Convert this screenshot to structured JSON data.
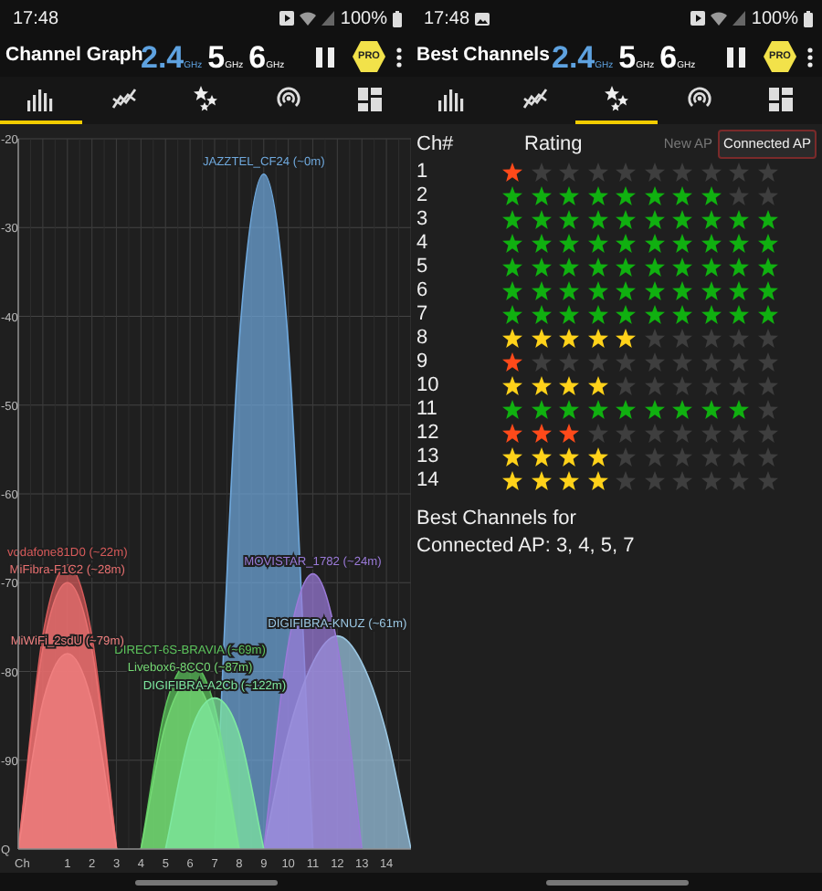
{
  "screens": [
    {
      "status_bar": {
        "time": "17:48",
        "notification": false,
        "battery": "100%"
      },
      "title": "Channel Graph",
      "bands": [
        {
          "value": "2.4",
          "unit": "GHz",
          "selected": true
        },
        {
          "value": "5",
          "unit": "GHz",
          "selected": false
        },
        {
          "value": "6",
          "unit": "GHz",
          "selected": false
        }
      ],
      "pro_badge": "PRO",
      "tabs": [
        {
          "selected": true
        },
        {
          "selected": false
        },
        {
          "selected": false
        },
        {
          "selected": false
        },
        {
          "selected": false
        }
      ],
      "chart_data": {
        "type": "area",
        "grid": true,
        "xlabel": "Ch",
        "x": [
          -1,
          0,
          1,
          2,
          3,
          4,
          5,
          6,
          7,
          8,
          9,
          10,
          11,
          12,
          13,
          14,
          15
        ],
        "xlim": [
          -1,
          15
        ],
        "ylim": [
          -100,
          -20
        ],
        "xticks": [
          1,
          2,
          3,
          4,
          5,
          6,
          7,
          8,
          9,
          10,
          11,
          12,
          13,
          14
        ],
        "yticks": [
          -20,
          -30,
          -40,
          -50,
          -60,
          -70,
          -80,
          -90,
          {
            "value": -100,
            "label": "Q"
          }
        ],
        "series": [
          {
            "name": "JAZZTEL_CF24 (~0m)",
            "color": "#6fa8dc",
            "values": [
              null,
              null,
              null,
              null,
              null,
              null,
              null,
              null,
              -100,
              -43,
              -24,
              -43,
              -100,
              null,
              null,
              null,
              null
            ]
          },
          {
            "name": "DIGIFIBRA-KNUZ (~61m)",
            "color": "#9cc8e4",
            "values": [
              null,
              null,
              null,
              null,
              null,
              null,
              null,
              null,
              null,
              null,
              -100,
              -87,
              -79,
              -76,
              -79,
              -87,
              -100
            ]
          },
          {
            "name": "MOVISTAR_1782 (~24m)",
            "color": "#9a7ad8",
            "values": [
              null,
              null,
              null,
              null,
              null,
              null,
              null,
              null,
              null,
              null,
              -100,
              -77,
              -69,
              -77,
              -100,
              null,
              null
            ]
          },
          {
            "name": "DIRECT-6S-BRAVIA (~69m)",
            "color": "#5cc45c",
            "values": [
              null,
              null,
              null,
              null,
              null,
              -100,
              -84,
              -79,
              -84,
              -100,
              null,
              null,
              null,
              null,
              null,
              null,
              null
            ]
          },
          {
            "name": "Livebox6-8CC0 (~87m)",
            "color": "#74d874",
            "values": [
              null,
              null,
              null,
              null,
              null,
              -100,
              -86,
              -81,
              -86,
              -100,
              null,
              null,
              null,
              null,
              null,
              null,
              null
            ]
          },
          {
            "name": "DIGIFIBRA-A2Cb (~122m)",
            "color": "#7ee8a0",
            "values": [
              null,
              null,
              null,
              null,
              null,
              null,
              -100,
              -87,
              -83,
              -87,
              -100,
              null,
              null,
              null,
              null,
              null,
              null
            ]
          },
          {
            "name": "vodafone81D0 (~22m)",
            "color": "#d65a5a",
            "values": [
              -100,
              -76,
              -68,
              -76,
              -100,
              null,
              null,
              null,
              null,
              null,
              null,
              null,
              null,
              null,
              null,
              null,
              null
            ]
          },
          {
            "name": "MiFibra-F1C2 (~28m)",
            "color": "#e87070",
            "values": [
              -100,
              -77.5,
              -70,
              -77.5,
              -100,
              null,
              null,
              null,
              null,
              null,
              null,
              null,
              null,
              null,
              null,
              null,
              null
            ]
          },
          {
            "name": "MiWiFi_2sdU (~79m)",
            "color": "#f08080",
            "values": [
              -100,
              -83.5,
              -78,
              -83.5,
              -100,
              null,
              null,
              null,
              null,
              null,
              null,
              null,
              null,
              null,
              null,
              null,
              null
            ]
          }
        ]
      }
    },
    {
      "status_bar": {
        "time": "17:48",
        "notification": true,
        "battery": "100%"
      },
      "title": "Best Channels",
      "bands": [
        {
          "value": "2.4",
          "unit": "GHz",
          "selected": true
        },
        {
          "value": "5",
          "unit": "GHz",
          "selected": false
        },
        {
          "value": "6",
          "unit": "GHz",
          "selected": false
        }
      ],
      "pro_badge": "PRO",
      "tabs": [
        {
          "selected": false
        },
        {
          "selected": false
        },
        {
          "selected": true
        },
        {
          "selected": false
        },
        {
          "selected": false
        }
      ],
      "columns": [
        "Ch#",
        "Rating"
      ],
      "ap_toggle": [
        {
          "label": "New AP",
          "selected": false
        },
        {
          "label": "Connected AP",
          "selected": true
        }
      ],
      "channels": [
        {
          "ch": "1",
          "stars": 1,
          "color": "#ff4a1a"
        },
        {
          "ch": "2",
          "stars": 8,
          "color": "#10b010"
        },
        {
          "ch": "3",
          "stars": 10,
          "color": "#10b010"
        },
        {
          "ch": "4",
          "stars": 10,
          "color": "#10b010"
        },
        {
          "ch": "5",
          "stars": 10,
          "color": "#10b010"
        },
        {
          "ch": "6",
          "stars": 10,
          "color": "#10b010"
        },
        {
          "ch": "7",
          "stars": 10,
          "color": "#10b010"
        },
        {
          "ch": "8",
          "stars": 5,
          "color": "#ffd21a"
        },
        {
          "ch": "9",
          "stars": 1,
          "color": "#ff4a1a"
        },
        {
          "ch": "10",
          "stars": 4,
          "color": "#ffd21a"
        },
        {
          "ch": "11",
          "stars": 9,
          "color": "#10b010"
        },
        {
          "ch": "12",
          "stars": 3,
          "color": "#ff4a1a"
        },
        {
          "ch": "13",
          "stars": 4,
          "color": "#ffd21a"
        },
        {
          "ch": "14",
          "stars": 4,
          "color": "#ffd21a"
        }
      ],
      "summary": "Best Channels for\nConnected AP: 3, 4, 5, 7"
    }
  ]
}
